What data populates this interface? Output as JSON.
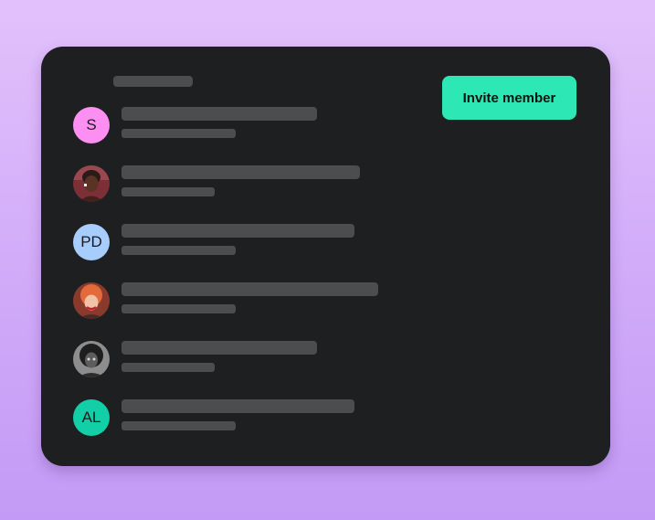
{
  "colors": {
    "page_gradient_top": "#e2c1fb",
    "page_gradient_bottom": "#c39af5",
    "card_background": "#1d1f20",
    "placeholder": "#4b4d4e",
    "accent": "#2de8b4"
  },
  "header": {
    "invite_button_label": "Invite member"
  },
  "members": [
    {
      "kind": "initials",
      "initials": "S",
      "avatar_color": "#fd8ff3"
    },
    {
      "kind": "photo",
      "icon": "person-photo-icon"
    },
    {
      "kind": "initials",
      "initials": "PD",
      "avatar_color": "#a7cdfc"
    },
    {
      "kind": "photo",
      "icon": "person-photo-icon"
    },
    {
      "kind": "photo",
      "icon": "person-photo-icon"
    },
    {
      "kind": "initials",
      "initials": "AL",
      "avatar_color": "#13cfa8"
    }
  ]
}
